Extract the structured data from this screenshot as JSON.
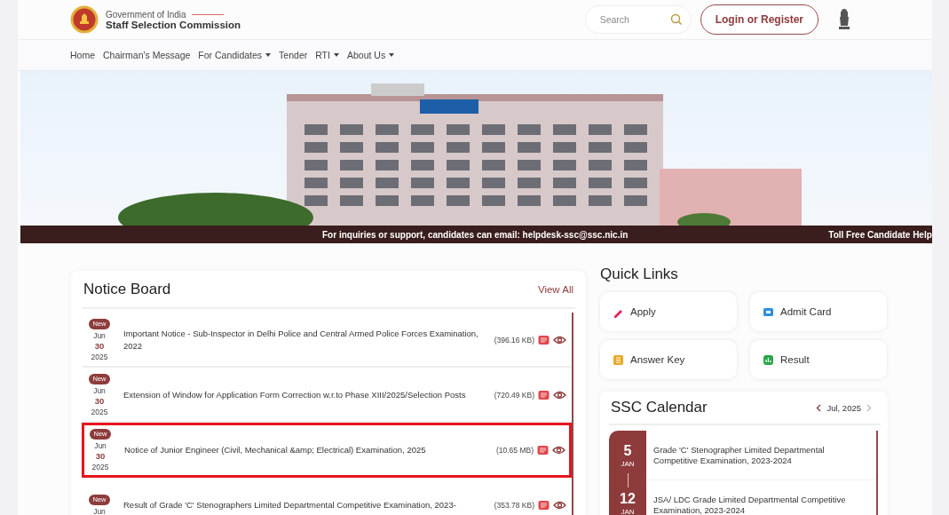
{
  "header": {
    "org_line": "Government of India",
    "org_name": "Staff Selection Commission",
    "search": {
      "placeholder": "Search"
    },
    "login_button": "Login or Register"
  },
  "nav": [
    {
      "label": "Home",
      "has_menu": false
    },
    {
      "label": "Chairman's Message",
      "has_menu": false
    },
    {
      "label": "For Candidates",
      "has_menu": true
    },
    {
      "label": "Tender",
      "has_menu": false
    },
    {
      "label": "RTI",
      "has_menu": true
    },
    {
      "label": "About Us",
      "has_menu": true
    }
  ],
  "ticker": [
    "For inquiries or support, candidates can email: helpdesk-ssc@ssc.nic.in",
    "Toll Free Candidate Help"
  ],
  "notice_board": {
    "title": "Notice Board",
    "view_all": "View All",
    "notices": [
      {
        "badge": "New",
        "month": "Jun",
        "day": "30",
        "year": "2025",
        "title": "Important Notice - Sub-Inspector in Delhi Police and Central Armed Police Forces Examination, 2022",
        "size": "(396.16 KB)",
        "highlighted": false
      },
      {
        "badge": "New",
        "month": "Jun",
        "day": "30",
        "year": "2025",
        "title": "Extension of Window for Application Form Correction w.r.to Phase XIII/2025/Selection Posts",
        "size": "(720.49 KB)",
        "highlighted": false
      },
      {
        "badge": "New",
        "month": "Jun",
        "day": "30",
        "year": "2025",
        "title": "Notice of Junior Engineer (Civil, Mechanical &amp; Electrical) Examination, 2025",
        "size": "(10.65 MB)",
        "highlighted": true
      },
      {
        "badge": "New",
        "month": "Jun",
        "title": "Result of Grade 'C' Stenographers Limited Departmental Competitive Examination, 2023-",
        "size": "(353.78 KB)",
        "highlighted": false
      }
    ]
  },
  "quick_links": {
    "title": "Quick Links",
    "links": [
      {
        "label": "Apply",
        "kind": "pencil"
      },
      {
        "label": "Admit Card",
        "kind": "card"
      },
      {
        "label": "Answer Key",
        "kind": "list"
      },
      {
        "label": "Result",
        "kind": "chart"
      }
    ]
  },
  "calendar": {
    "title": "SSC Calendar",
    "month": "Jul, 2025",
    "prev_disabled": false,
    "next_disabled": true,
    "events": [
      {
        "day": "5",
        "month": "JAN",
        "title": "Grade 'C' Stenographer Limited Departmental Competitive Examination, 2023-2024"
      },
      {
        "day": "12",
        "month": "JAN",
        "title": "JSA/ LDC Grade Limited Departmental Competitive Examination, 2023-2024"
      }
    ]
  }
}
